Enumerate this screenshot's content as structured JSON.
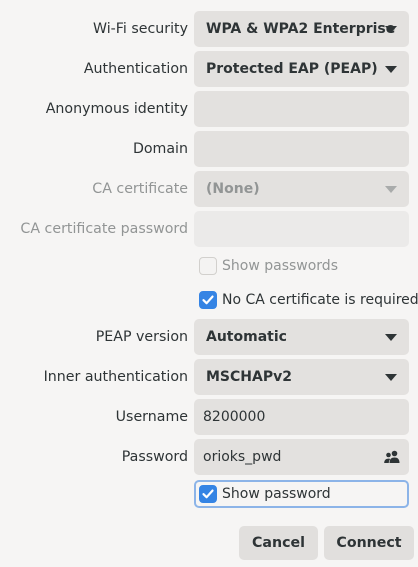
{
  "fields": {
    "wifi_security": {
      "label": "Wi-Fi security",
      "value": "WPA & WPA2 Enterprise"
    },
    "authentication": {
      "label": "Authentication",
      "value": "Protected EAP (PEAP)"
    },
    "anonymous_identity": {
      "label": "Anonymous identity",
      "value": ""
    },
    "domain": {
      "label": "Domain",
      "value": ""
    },
    "ca_certificate": {
      "label": "CA certificate",
      "value": "(None)"
    },
    "ca_certificate_password": {
      "label": "CA certificate password",
      "value": ""
    },
    "show_passwords": {
      "label": "Show passwords",
      "checked": false,
      "disabled": true
    },
    "no_ca_required": {
      "label": "No CA certificate is required",
      "checked": true
    },
    "peap_version": {
      "label": "PEAP version",
      "value": "Automatic"
    },
    "inner_authentication": {
      "label": "Inner authentication",
      "value": "MSCHAPv2"
    },
    "username": {
      "label": "Username",
      "value": "8200000"
    },
    "password": {
      "label": "Password",
      "value": "orioks_pwd"
    },
    "show_password": {
      "label": "Show password",
      "checked": true
    }
  },
  "buttons": {
    "cancel": "Cancel",
    "connect": "Connect"
  },
  "colors": {
    "background": "#f6f5f4",
    "field": "#e3e1df",
    "accent": "#3584e4",
    "disabled_text": "#929595"
  },
  "icons": {
    "dropdown": "pan-down-icon",
    "password_storage": "users-icon",
    "checkmark": "check-icon"
  }
}
